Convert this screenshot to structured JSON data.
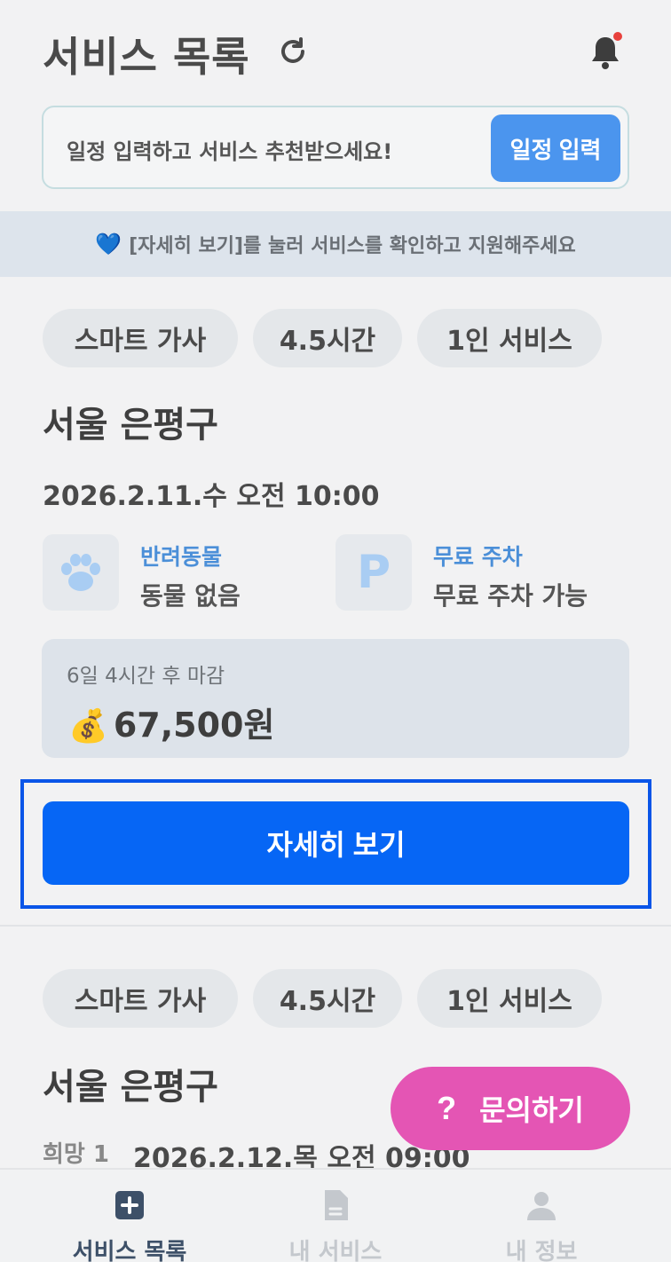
{
  "header": {
    "title": "서비스 목록"
  },
  "schedule": {
    "prompt": "일정 입력하고 서비스 추천받으세요!",
    "button": "일정 입력"
  },
  "notice": {
    "icon": "💙",
    "text": "[자세히 보기]를 눌러 서비스를 확인하고 지원해주세요"
  },
  "services": [
    {
      "tags": [
        "스마트 가사",
        "4.5시간",
        "1인 서비스"
      ],
      "region": "서울 은평구",
      "datetime": "2026.2.11.수 오전 10:00",
      "features": [
        {
          "label": "반려동물",
          "value": "동물 없음",
          "icon": "paw-icon"
        },
        {
          "label": "무료 주차",
          "value": "무료 주차 가능",
          "icon": "parking-icon",
          "icon_text": "P"
        }
      ],
      "deadline": "6일 4시간 후 마감",
      "price_icon": "💰",
      "price": "67,500원",
      "detail_button": "자세히 보기"
    },
    {
      "tags": [
        "스마트 가사",
        "4.5시간",
        "1인 서비스"
      ],
      "region": "서울 은평구",
      "preference": "희망 1",
      "datetime": "2026.2.12.목 오전 09:00"
    }
  ],
  "inquiry": {
    "icon": "?",
    "label": "문의하기"
  },
  "bottom_nav": [
    {
      "label": "서비스 목록",
      "icon": "plus-square-icon",
      "active": true
    },
    {
      "label": "내 서비스",
      "icon": "document-icon",
      "active": false
    },
    {
      "label": "내 정보",
      "icon": "person-icon",
      "active": false
    }
  ],
  "colors": {
    "primary": "#0666f5",
    "schedule_button": "#4b95ee",
    "inquiry": "#e455b4",
    "notification_dot": "#e8413c",
    "nav_active": "#3d5068",
    "nav_inactive": "#c4c8cd"
  }
}
